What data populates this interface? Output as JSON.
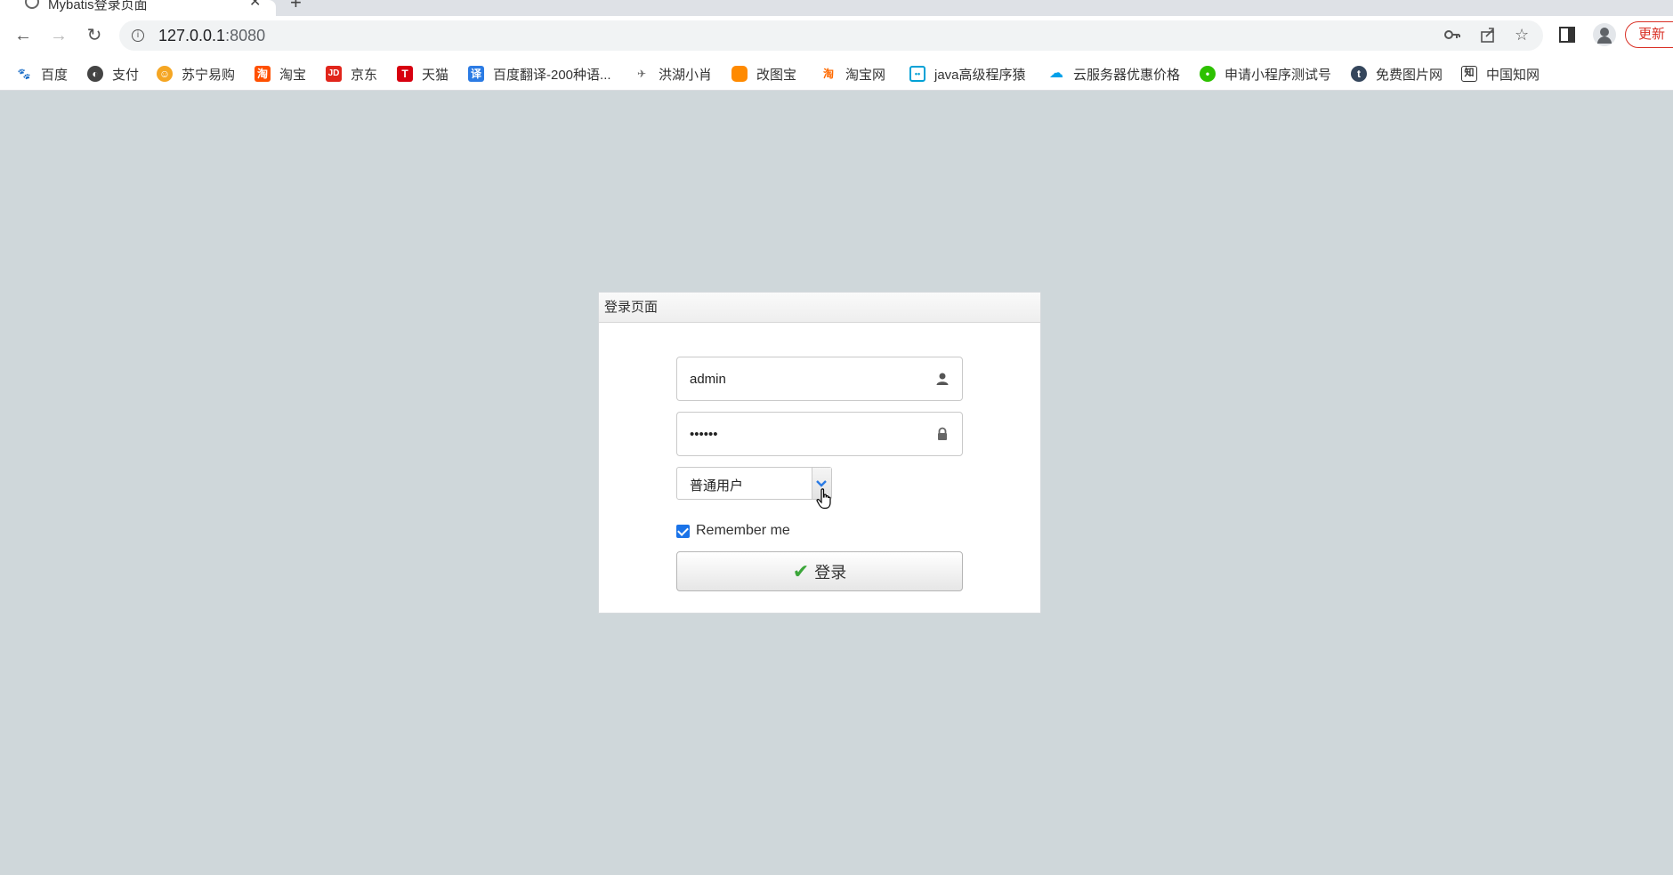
{
  "browser": {
    "tab": {
      "title": "Mybatis登录页面"
    },
    "address": {
      "host": "127.0.0.1",
      "port": ":8080"
    },
    "update_label": "更新",
    "bookmarks": [
      {
        "label": "百度",
        "icon": "baidu-paw-icon",
        "color": "#2932e1"
      },
      {
        "label": "支付",
        "icon": "globe-icon",
        "color": "#444444"
      },
      {
        "label": "苏宁易购",
        "icon": "suning-lion-icon",
        "color": "#f5a623"
      },
      {
        "label": "淘宝",
        "icon": "taobao-icon",
        "color": "#ff5000"
      },
      {
        "label": "京东",
        "icon": "jd-icon",
        "color": "#e1251b"
      },
      {
        "label": "天猫",
        "icon": "tmall-icon",
        "color": "#d7000f"
      },
      {
        "label": "百度翻译-200种语...",
        "icon": "translate-icon",
        "color": "#2b7be4"
      },
      {
        "label": "洪湖小肖",
        "icon": "bird-icon",
        "color": "#666666"
      },
      {
        "label": "改图宝",
        "icon": "gaitubao-icon",
        "color": "#ff8a00"
      },
      {
        "label": "淘宝网",
        "icon": "taobao-tao-icon",
        "color": "#ff6a00"
      },
      {
        "label": "java高级程序猿",
        "icon": "bilibili-tv-icon",
        "color": "#00a1d6"
      },
      {
        "label": "云服务器优惠价格",
        "icon": "cloud-icon",
        "color": "#00a0e9"
      },
      {
        "label": "申请小程序测试号",
        "icon": "wechat-icon",
        "color": "#2dc100"
      },
      {
        "label": "免费图片网",
        "icon": "tumblr-icon",
        "color": "#35465c"
      },
      {
        "label": "中国知网",
        "icon": "cnki-icon",
        "color": "#333333"
      }
    ]
  },
  "panel": {
    "title": "登录页面",
    "username": {
      "value": "admin",
      "icon": "user-icon"
    },
    "password": {
      "value": "••••••",
      "icon": "lock-icon"
    },
    "role_select": {
      "selected": "普通用户"
    },
    "remember": {
      "label": "Remember me",
      "checked": true
    },
    "submit": {
      "label": "登录",
      "icon": "checkmark-icon"
    }
  },
  "colors": {
    "page_bg": "#cfd7da",
    "accent": "#1a73e8",
    "check_green": "#3ba639",
    "update_red": "#d93025"
  }
}
